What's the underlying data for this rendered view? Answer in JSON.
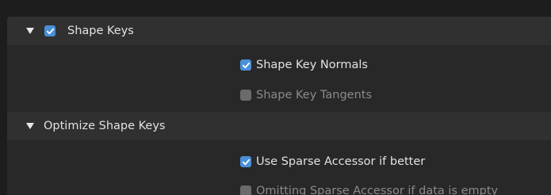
{
  "shape_keys_section": {
    "label": "Shape Keys",
    "expanded": true,
    "enabled": true
  },
  "shape_keys_options": {
    "normals_label": "Shape Key Normals",
    "normals_checked": true,
    "tangents_label": "Shape Key Tangents",
    "tangents_checked": false
  },
  "optimize_section": {
    "label": "Optimize Shape Keys",
    "expanded": true
  },
  "optimize_options": {
    "sparse_label": "Use Sparse Accessor if better",
    "sparse_checked": true,
    "omit_label": "Omitting Sparse Accessor if data is empty",
    "omit_checked": false
  },
  "colors": {
    "accent": "#4a90d9",
    "header_bg": "#303030",
    "body_bg": "#282828",
    "window_bg": "#1d1d1d"
  }
}
